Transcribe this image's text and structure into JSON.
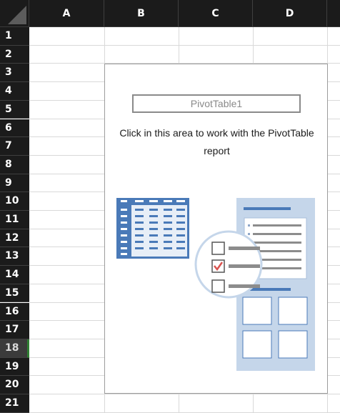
{
  "columns": [
    "A",
    "B",
    "C",
    "D"
  ],
  "rows": [
    "1",
    "2",
    "3",
    "4",
    "5",
    "6",
    "7",
    "8",
    "9",
    "10",
    "11",
    "12",
    "13",
    "14",
    "15",
    "16",
    "17",
    "18",
    "19",
    "20",
    "21"
  ],
  "selected_row": "18",
  "pivot": {
    "name": "PivotTable1",
    "message": "Click in this area to work with the PivotTable report"
  },
  "colors": {
    "header_bg": "#1b1b1b",
    "header_text": "#ffffff",
    "accent_blue": "#4a7ab8",
    "light_blue": "#c5d6ea",
    "check_red": "#d9534f",
    "selected_row_marker": "#2e7d32"
  },
  "icons": {
    "pivot_illustration": "pivot-table-field-list-illustration",
    "corner": "select-all-triangle-icon"
  }
}
